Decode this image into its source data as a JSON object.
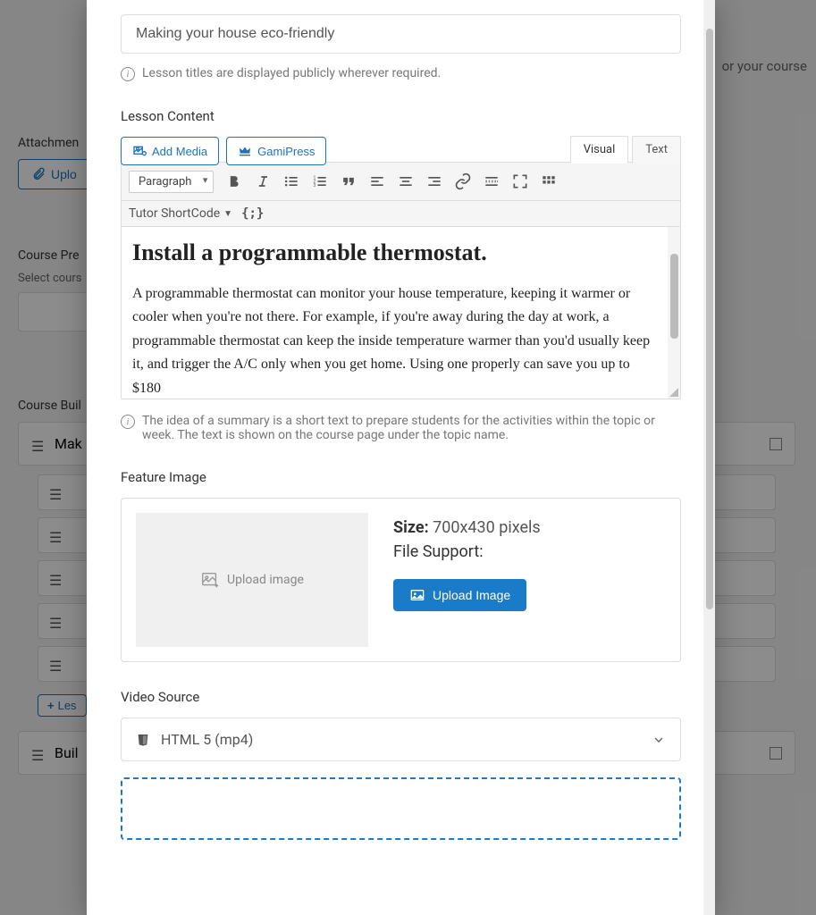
{
  "background": {
    "rightText": "or your course",
    "attachLabel": "Attachmen",
    "uploadBtn": "Uplo",
    "prereqLabel": "Course Pre",
    "prereqHint": "Select cours",
    "buildLabel": "Course Buil",
    "topic1": "Mak",
    "topic2": "Buil",
    "lessonBtn": "Les"
  },
  "modal": {
    "titleValue": "Making your house eco-friendly",
    "titleHint": "Lesson titles are displayed publicly wherever required.",
    "contentLabel": "Lesson Content",
    "addMedia": "Add Media",
    "gamipress": "GamiPress",
    "tabVisual": "Visual",
    "tabText": "Text",
    "paragraph": "Paragraph",
    "shortcode": "Tutor ShortCode",
    "editorHeading": "Install a programmable thermostat.",
    "editorBody": "A programmable thermostat can monitor your house temperature, keeping it warmer or cooler when you're not there. For example, if you're away during the day at work, a programmable thermostat can keep the inside temperature warmer than you'd usually keep it, and trigger the A/C only when you get home. Using one properly can save you up to $180",
    "summaryHint": "The idea of a summary is a short text to prepare students for the activities within the topic or week. The text is shown on the course page under the topic name.",
    "featureLabel": "Feature Image",
    "uploadPlaceholder": "Upload image",
    "sizeLabel": "Size:",
    "sizeValue": "700x430 pixels",
    "fileSupportLabel": "File Support:",
    "uploadImageBtn": "Upload Image",
    "videoLabel": "Video Source",
    "videoValue": "HTML 5 (mp4)"
  }
}
